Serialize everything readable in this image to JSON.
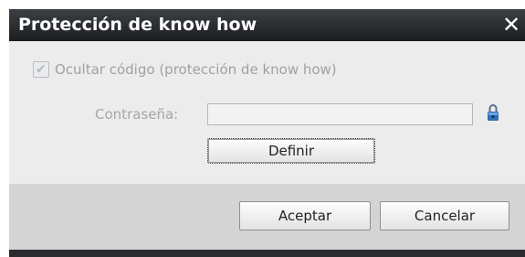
{
  "dialog": {
    "title": "Protección de know how",
    "close_symbol": "✕"
  },
  "options": {
    "hide_code_label": "Ocultar código (protección de know how)",
    "hide_code_checked": true,
    "hide_code_enabled": false,
    "check_icon": "check-icon"
  },
  "password": {
    "label": "Contraseña:",
    "value": "",
    "enabled": false,
    "lock_icon": "lock-icon",
    "lock_color": "#2f6fb6"
  },
  "buttons": {
    "define_label": "Definir",
    "accept_label": "Aceptar",
    "cancel_label": "Cancelar"
  },
  "colors": {
    "titlebar": "#2a2c30",
    "content_bg": "#ececec",
    "footer_bg": "#d4d4d4"
  }
}
